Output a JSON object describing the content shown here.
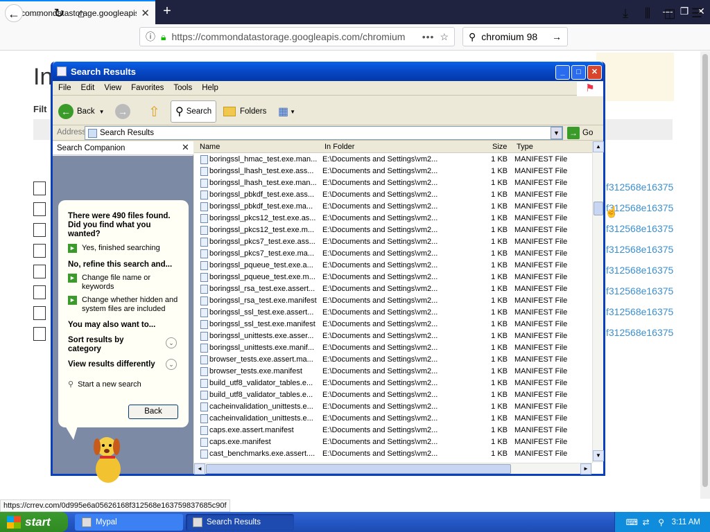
{
  "browser": {
    "tab_title": "commondatastorage.googleapis.c",
    "new_tab": "+",
    "url": "https://commondatastorage.googleapis.com/chromium",
    "search_query": "chromium 98",
    "status_url": "https://crrev.com/0d995e6a05626168f312568e163759837685c90f"
  },
  "page": {
    "title": "In",
    "filter_label": "Filt",
    "link_text": "f312568e16375"
  },
  "window": {
    "title": "Search Results",
    "menu": [
      "File",
      "Edit",
      "View",
      "Favorites",
      "Tools",
      "Help"
    ],
    "toolbar": {
      "back": "Back",
      "search": "Search",
      "folders": "Folders"
    },
    "address_label": "Address",
    "address_value": "Search Results",
    "go": "Go"
  },
  "companion": {
    "header": "Search Companion",
    "found_text": "There were 490 files found. Did you find what you wanted?",
    "yes_option": "Yes, finished searching",
    "refine_heading": "No, refine this search and...",
    "refine_opt1": "Change file name or keywords",
    "refine_opt2": "Change whether hidden and system files are included",
    "also_heading": "You may also want to...",
    "sort_option": "Sort results by category",
    "view_option": "View results differently",
    "new_search": "Start a new search",
    "back_button": "Back"
  },
  "columns": {
    "name": "Name",
    "folder": "In Folder",
    "size": "Size",
    "type": "Type"
  },
  "rows": [
    {
      "name": "boringssl_hmac_test.exe.man...",
      "folder": "E:\\Documents and Settings\\vm2...",
      "size": "1 KB",
      "type": "MANIFEST File"
    },
    {
      "name": "boringssl_lhash_test.exe.ass...",
      "folder": "E:\\Documents and Settings\\vm2...",
      "size": "1 KB",
      "type": "MANIFEST File"
    },
    {
      "name": "boringssl_lhash_test.exe.man...",
      "folder": "E:\\Documents and Settings\\vm2...",
      "size": "1 KB",
      "type": "MANIFEST File"
    },
    {
      "name": "boringssl_pbkdf_test.exe.ass...",
      "folder": "E:\\Documents and Settings\\vm2...",
      "size": "1 KB",
      "type": "MANIFEST File"
    },
    {
      "name": "boringssl_pbkdf_test.exe.ma...",
      "folder": "E:\\Documents and Settings\\vm2...",
      "size": "1 KB",
      "type": "MANIFEST File"
    },
    {
      "name": "boringssl_pkcs12_test.exe.as...",
      "folder": "E:\\Documents and Settings\\vm2...",
      "size": "1 KB",
      "type": "MANIFEST File"
    },
    {
      "name": "boringssl_pkcs12_test.exe.m...",
      "folder": "E:\\Documents and Settings\\vm2...",
      "size": "1 KB",
      "type": "MANIFEST File"
    },
    {
      "name": "boringssl_pkcs7_test.exe.ass...",
      "folder": "E:\\Documents and Settings\\vm2...",
      "size": "1 KB",
      "type": "MANIFEST File"
    },
    {
      "name": "boringssl_pkcs7_test.exe.ma...",
      "folder": "E:\\Documents and Settings\\vm2...",
      "size": "1 KB",
      "type": "MANIFEST File"
    },
    {
      "name": "boringssl_pqueue_test.exe.a...",
      "folder": "E:\\Documents and Settings\\vm2...",
      "size": "1 KB",
      "type": "MANIFEST File"
    },
    {
      "name": "boringssl_pqueue_test.exe.m...",
      "folder": "E:\\Documents and Settings\\vm2...",
      "size": "1 KB",
      "type": "MANIFEST File"
    },
    {
      "name": "boringssl_rsa_test.exe.assert...",
      "folder": "E:\\Documents and Settings\\vm2...",
      "size": "1 KB",
      "type": "MANIFEST File"
    },
    {
      "name": "boringssl_rsa_test.exe.manifest",
      "folder": "E:\\Documents and Settings\\vm2...",
      "size": "1 KB",
      "type": "MANIFEST File"
    },
    {
      "name": "boringssl_ssl_test.exe.assert...",
      "folder": "E:\\Documents and Settings\\vm2...",
      "size": "1 KB",
      "type": "MANIFEST File"
    },
    {
      "name": "boringssl_ssl_test.exe.manifest",
      "folder": "E:\\Documents and Settings\\vm2...",
      "size": "1 KB",
      "type": "MANIFEST File"
    },
    {
      "name": "boringssl_unittests.exe.asser...",
      "folder": "E:\\Documents and Settings\\vm2...",
      "size": "1 KB",
      "type": "MANIFEST File"
    },
    {
      "name": "boringssl_unittests.exe.manif...",
      "folder": "E:\\Documents and Settings\\vm2...",
      "size": "1 KB",
      "type": "MANIFEST File"
    },
    {
      "name": "browser_tests.exe.assert.ma...",
      "folder": "E:\\Documents and Settings\\vm2...",
      "size": "1 KB",
      "type": "MANIFEST File"
    },
    {
      "name": "browser_tests.exe.manifest",
      "folder": "E:\\Documents and Settings\\vm2...",
      "size": "1 KB",
      "type": "MANIFEST File"
    },
    {
      "name": "build_utf8_validator_tables.e...",
      "folder": "E:\\Documents and Settings\\vm2...",
      "size": "1 KB",
      "type": "MANIFEST File"
    },
    {
      "name": "build_utf8_validator_tables.e...",
      "folder": "E:\\Documents and Settings\\vm2...",
      "size": "1 KB",
      "type": "MANIFEST File"
    },
    {
      "name": "cacheinvalidation_unittests.e...",
      "folder": "E:\\Documents and Settings\\vm2...",
      "size": "1 KB",
      "type": "MANIFEST File"
    },
    {
      "name": "cacheinvalidation_unittests.e...",
      "folder": "E:\\Documents and Settings\\vm2...",
      "size": "1 KB",
      "type": "MANIFEST File"
    },
    {
      "name": "caps.exe.assert.manifest",
      "folder": "E:\\Documents and Settings\\vm2...",
      "size": "1 KB",
      "type": "MANIFEST File"
    },
    {
      "name": "caps.exe.manifest",
      "folder": "E:\\Documents and Settings\\vm2...",
      "size": "1 KB",
      "type": "MANIFEST File"
    },
    {
      "name": "cast_benchmarks.exe.assert....",
      "folder": "E:\\Documents and Settings\\vm2...",
      "size": "1 KB",
      "type": "MANIFEST File"
    }
  ],
  "taskbar": {
    "start": "start",
    "task1": "Mypal",
    "task2": "Search Results",
    "clock": "3:11 AM"
  }
}
